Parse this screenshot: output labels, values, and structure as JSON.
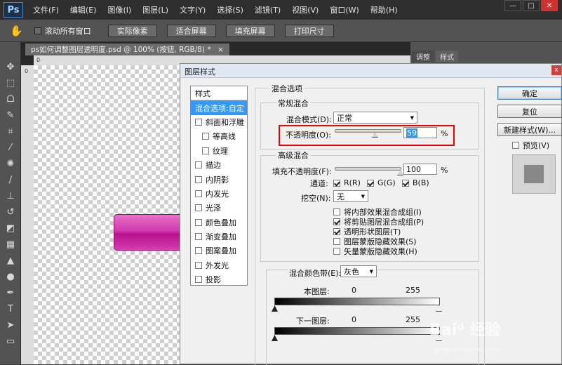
{
  "app": {
    "logo": "Ps"
  },
  "menu": [
    "文件(F)",
    "编辑(E)",
    "图像(I)",
    "图层(L)",
    "文字(Y)",
    "选择(S)",
    "滤镜(T)",
    "视图(V)",
    "窗口(W)",
    "帮助(H)"
  ],
  "window_controls": {
    "minimize": "—",
    "maximize": "□",
    "close": "✕"
  },
  "options": {
    "scroll_all": "滚动所有窗口",
    "actual_pixels": "实际像素",
    "fit_screen": "适合屏幕",
    "fill_screen": "填充屏幕",
    "print_size": "打印尺寸"
  },
  "document": {
    "tab_title": "ps如何调整图层透明度.psd @ 100% (按钮, RGB/8) *",
    "close": "×"
  },
  "ruler": {
    "zero": "0"
  },
  "panel": {
    "tab1": "调整",
    "tab2": "样式"
  },
  "dialog": {
    "title": "图层样式",
    "close": "x",
    "styles_header": "样式",
    "styles": [
      "混合选项:自定",
      "斜面和浮雕",
      "等高线",
      "纹理",
      "描边",
      "内阴影",
      "内发光",
      "光泽",
      "颜色叠加",
      "渐变叠加",
      "图案叠加",
      "外发光",
      "投影"
    ],
    "blend_options": "混合选项",
    "general_blending": "常规混合",
    "blend_mode_label": "混合模式(D):",
    "blend_mode_value": "正常",
    "opacity_label": "不透明度(O):",
    "opacity_value": "59",
    "opacity_level": 59,
    "percent": "%",
    "advanced_blending": "高级混合",
    "fill_opacity_label": "填充不透明度(F):",
    "fill_opacity_value": "100",
    "fill_opacity_level": 100,
    "channels_label": "通道:",
    "channel_r": "R(R)",
    "channel_g": "G(G)",
    "channel_b": "B(B)",
    "knockout_label": "挖空(N):",
    "knockout_value": "无",
    "adv_options": [
      "将内部效果混合成组(I)",
      "将剪贴图层混合成组(P)",
      "透明形状图层(T)",
      "图层蒙版隐藏效果(S)",
      "矢量蒙版隐藏效果(H)"
    ],
    "blend_if_label": "混合颜色带(E):",
    "blend_if_value": "灰色",
    "this_layer": "本图层:",
    "underlying_layer": "下一图层:",
    "range_min": "0",
    "range_max": "255",
    "ok": "确定",
    "reset": "复位",
    "new_style": "新建样式(W)...",
    "preview": "预览(V)"
  },
  "watermark": {
    "text": "Baiᵈ 经验",
    "url": "jingyan.baidu.com"
  }
}
